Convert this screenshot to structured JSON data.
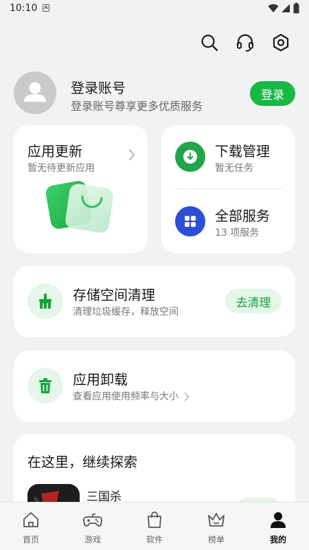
{
  "status_bar": {
    "time": "10:10",
    "notification_glyph": "A"
  },
  "header": {
    "icons": [
      "search-icon",
      "headset-icon",
      "settings-icon"
    ]
  },
  "profile": {
    "title": "登录账号",
    "subtitle": "登录账号尊享更多优质服务",
    "login_label": "登录"
  },
  "app_update": {
    "title": "应用更新",
    "subtitle": "暂无待更新应用"
  },
  "services": [
    {
      "title": "下载管理",
      "subtitle": "暂无任务",
      "icon": "download-icon",
      "color": "#22a64b"
    },
    {
      "title": "全部服务",
      "subtitle": "13 项服务",
      "icon": "grid-icon",
      "color": "#2d4fd6"
    }
  ],
  "storage": {
    "title": "存储空间清理",
    "subtitle": "清理垃圾缓存，释放空间",
    "action_label": "去清理"
  },
  "uninstall": {
    "title": "应用卸载",
    "subtitle": "查看应用使用频率与大小"
  },
  "explore": {
    "title": "在这里，继续探索",
    "game_name": "三国杀"
  },
  "tabs": [
    {
      "label": "首页",
      "icon": "home-icon"
    },
    {
      "label": "游戏",
      "icon": "gamepad-icon"
    },
    {
      "label": "软件",
      "icon": "bag-icon"
    },
    {
      "label": "榜单",
      "icon": "crown-icon"
    },
    {
      "label": "我的",
      "icon": "person-icon",
      "active": true
    }
  ],
  "colors": {
    "accent": "#17b843",
    "accent_light": "#e3f6e7",
    "background": "#f1f2f4"
  }
}
